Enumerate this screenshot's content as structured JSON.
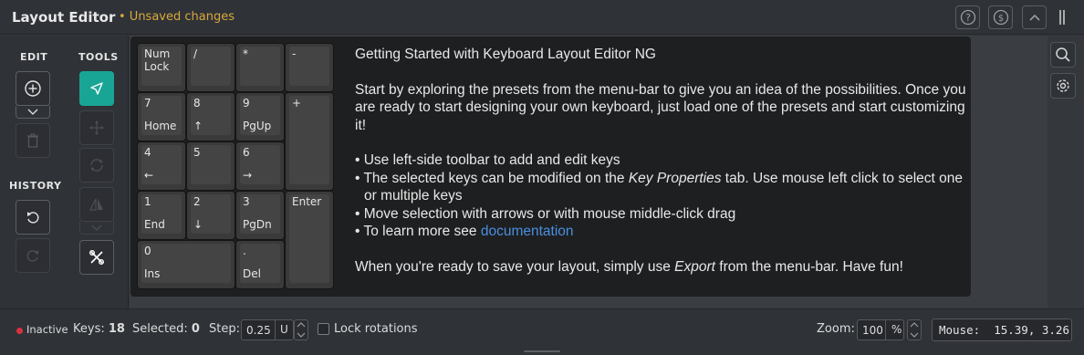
{
  "header": {
    "title": "Layout Editor",
    "unsaved": "• Unsaved changes"
  },
  "toolbar": {
    "edit_label": "EDIT",
    "tools_label": "TOOLS",
    "history_label": "HISTORY"
  },
  "keys": [
    {
      "top": "Num",
      "top2": "Lock",
      "bottom": ""
    },
    {
      "top": "/",
      "bottom": ""
    },
    {
      "top": "*",
      "bottom": ""
    },
    {
      "top": "-",
      "bottom": ""
    },
    {
      "top": "7",
      "bottom": "Home"
    },
    {
      "top": "8",
      "bottom": "↑"
    },
    {
      "top": "9",
      "bottom": "PgUp"
    },
    {
      "top": "+",
      "bottom": ""
    },
    {
      "top": "4",
      "bottom": "←"
    },
    {
      "top": "5",
      "bottom": ""
    },
    {
      "top": "6",
      "bottom": "→"
    },
    {
      "top": "1",
      "bottom": "End"
    },
    {
      "top": "2",
      "bottom": "↓"
    },
    {
      "top": "3",
      "bottom": "PgDn"
    },
    {
      "top": "Enter",
      "bottom": ""
    },
    {
      "top": "0",
      "bottom": "Ins"
    },
    {
      "top": ".",
      "bottom": "Del"
    }
  ],
  "info": {
    "heading": "Getting Started with Keyboard Layout Editor NG",
    "para1": "Start by exploring the presets from the menu-bar to give you an idea of the possibilities. Once you are ready to start designing your own keyboard, just load one of the presets and start customizing it!",
    "bullet1": "• Use left-side toolbar to add and edit keys",
    "bullet2_pre": "• The selected keys can be modified on the ",
    "bullet2_em": "Key Properties",
    "bullet2_post": " tab. Use mouse left click to select one or multiple keys",
    "bullet3": "• Move selection with arrows or with mouse middle-click drag",
    "bullet4_pre": "• To learn more see ",
    "bullet4_link": "documentation",
    "footer_pre": "When you're ready to save your layout, simply use ",
    "footer_em": "Export",
    "footer_post": " from the menu-bar. Have fun!"
  },
  "status": {
    "state": "Inactive",
    "keys_label": "Keys:",
    "keys_value": "18",
    "selected_label": "Selected:",
    "selected_value": "0",
    "step_label": "Step:",
    "step_value": "0.25",
    "step_unit": "U",
    "lock_rotations": "Lock rotations",
    "zoom_label": "Zoom:",
    "zoom_value": "100",
    "zoom_unit": "%",
    "mouse": "Mouse:  15.39, 3.26"
  },
  "colors": {
    "accent": "#19a596",
    "unsaved": "#d9a93a",
    "inactive_dot": "#d9333f",
    "link": "#4a8fe0"
  }
}
